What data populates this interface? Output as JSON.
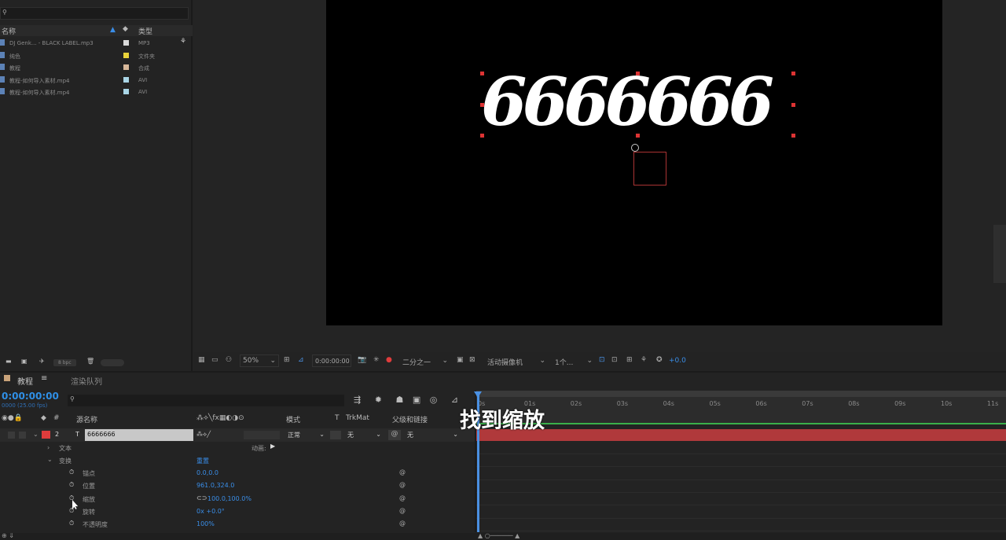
{
  "project": {
    "columns": {
      "name": "名称",
      "type": "类型"
    },
    "files": [
      {
        "name": "DJ Genk... - BLACK LABEL.mp3",
        "type": "MP3",
        "color": "#d9d9d9"
      },
      {
        "name": "纯色",
        "type": "文件夹",
        "color": "#e8d23a"
      },
      {
        "name": "教程",
        "type": "合成",
        "color": "#d8b89a"
      },
      {
        "name": "教程-如何导入素材.mp4",
        "type": "AVI",
        "color": "#a9d5e6"
      },
      {
        "name": "教程-如何导入素材.mp4",
        "type": "AVI",
        "color": "#a9d5e6"
      }
    ],
    "bpc": "8 bpc"
  },
  "viewer": {
    "text": "6666666",
    "zoom": "50%",
    "time": "0:00:00:00",
    "resolution": "二分之一",
    "camera": "活动摄像机",
    "views": "1个...",
    "exposure": "+0.0"
  },
  "timeline": {
    "tabs": [
      "教程",
      "渲染队列"
    ],
    "timecode": "0:00:00:00",
    "fps": "0000 (25.00 fps)",
    "headers": {
      "source": "源名称",
      "mode": "模式",
      "t": "T",
      "trkmat": "TrkMat",
      "parent": "父级和链接"
    },
    "layer": {
      "index": "2",
      "type": "T",
      "name": "6666666",
      "mode": "正常",
      "trkmat": "无",
      "parent": "无"
    },
    "props": {
      "text": "文本",
      "animate": "动画:",
      "transform": "变换",
      "reset": "重置",
      "anchor": {
        "label": "锚点",
        "value": "0.0,0.0"
      },
      "position": {
        "label": "位置",
        "value": "961.0,324.0"
      },
      "scale": {
        "label": "缩放",
        "value": "100.0,100.0%"
      },
      "rotation": {
        "label": "旋转",
        "value": "0x +0.0°"
      },
      "opacity": {
        "label": "不透明度",
        "value": "100%"
      }
    },
    "ruler": [
      "0s",
      "01s",
      "02s",
      "03s",
      "04s",
      "05s",
      "06s",
      "07s",
      "08s",
      "09s",
      "10s",
      "11s"
    ]
  },
  "subtitle": "找到缩放"
}
